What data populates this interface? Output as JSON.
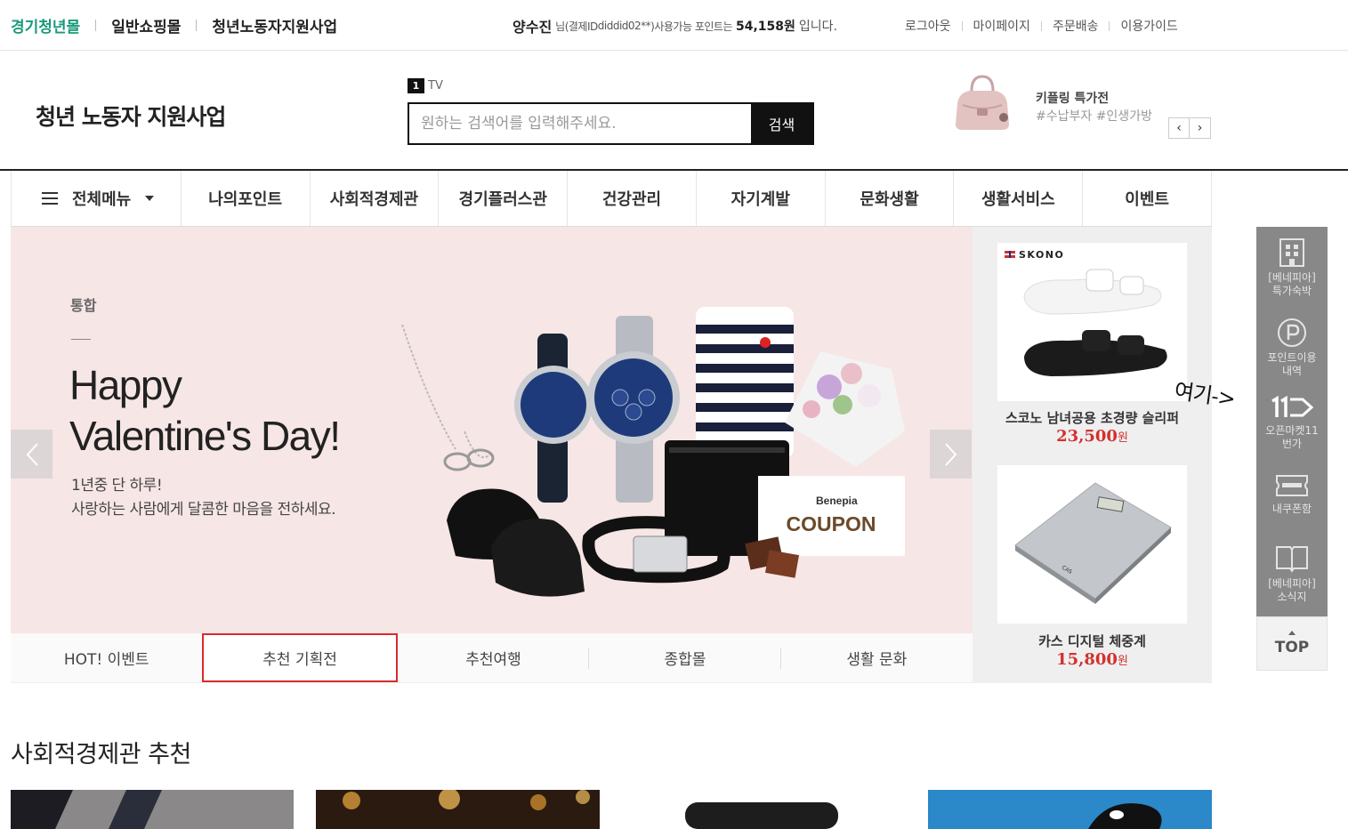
{
  "top_bar": {
    "mall_links": [
      "경기청년몰",
      "일반쇼핑몰",
      "청년노동자지원사업"
    ],
    "user_name": "양수진",
    "user_prefix": "님(결제ID",
    "user_id": "diddid02**",
    "user_mid": ")사용가능 포인트는",
    "points": "54,158원",
    "points_suffix": "입니다.",
    "util_links": [
      "로그아웃",
      "마이페이지",
      "주문배송",
      "이용가이드"
    ]
  },
  "header": {
    "logo": "청년 노동자 지원사업",
    "tv_rank": "1",
    "tv_label": "TV",
    "search_placeholder": "원하는 검색어를 입력해주세요.",
    "search_button": "검색",
    "promo_title": "키플링 특가전",
    "promo_tags": "#수납부자 #인생가방"
  },
  "nav": {
    "all_menu": "전체메뉴",
    "items": [
      "나의포인트",
      "사회적경제관",
      "경기플러스관",
      "건강관리",
      "자기계발",
      "문화생활",
      "생활서비스",
      "이벤트"
    ]
  },
  "hero": {
    "tag": "통합",
    "title_line1": "Happy",
    "title_line2": "Valentine's Day!",
    "sub_line1": "1년중 단 하루!",
    "sub_line2": "사랑하는 사람에게 달콤한 마음을 전하세요.",
    "coupon_brand": "Benepia",
    "coupon_text": "COUPON"
  },
  "banner_tabs": {
    "items": [
      "HOT! 이벤트",
      "추천 기획전",
      "추천여행",
      "종합몰",
      "생활 문화"
    ],
    "active_index": 1
  },
  "products": [
    {
      "brand": "SKONO",
      "name": "스코노 남녀공용 초경량 슬리퍼",
      "price": "23,500",
      "unit": "원"
    },
    {
      "brand": "CAS",
      "name": "카스 디지털 체중계",
      "price": "15,800",
      "unit": "원"
    }
  ],
  "quick_menu": {
    "items": [
      "[베네피아]\n특가숙박",
      "포인트이용\n내역",
      "오픈마켓11\n번가",
      "내쿠폰함",
      "[베네피아]\n소식지"
    ],
    "top": "TOP",
    "annotation": "여기->"
  },
  "section": {
    "title": "사회적경제관 추천"
  },
  "colors": {
    "brand_green": "#1a9a7a",
    "price_red": "#d4302f",
    "active_tab_border": "#d92b2b",
    "hero_bg": "#f7e6e6"
  }
}
